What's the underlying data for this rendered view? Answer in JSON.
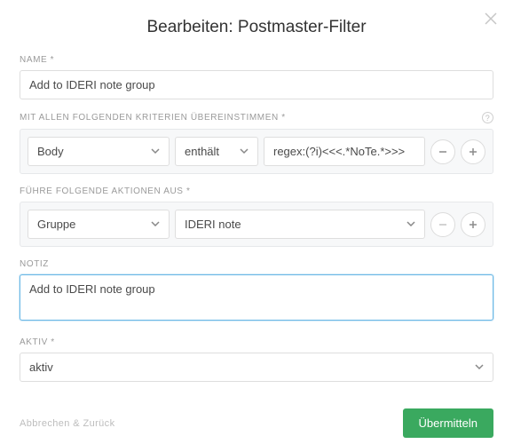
{
  "title": "Bearbeiten: Postmaster-Filter",
  "labels": {
    "name": "NAME *",
    "criteria": "MIT ALLEN FOLGENDEN KRITERIEN ÜBEREINSTIMMEN *",
    "actions": "FÜHRE FOLGENDE AKTIONEN AUS *",
    "note": "NOTIZ",
    "active": "AKTIV *"
  },
  "name_value": "Add to IDERI note group",
  "criteria": {
    "field": "Body",
    "operator": "enthält",
    "value": "regex:(?i)<<<.*NoTe.*>>>"
  },
  "action": {
    "type": "Gruppe",
    "target": "IDERI note"
  },
  "note_value": "Add to IDERI note group",
  "active_value": "aktiv",
  "footer": {
    "cancel": "Abbrechen & Zurück",
    "submit": "Übermitteln"
  },
  "colors": {
    "primary_button": "#3aa95f",
    "focus_border": "#6cb8e6",
    "panel_bg": "#f7f8f9"
  }
}
